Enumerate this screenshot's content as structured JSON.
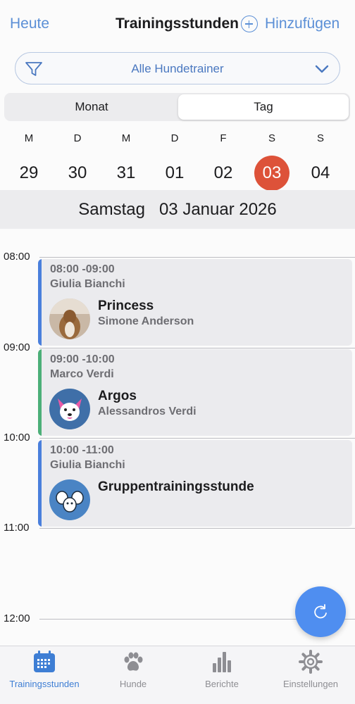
{
  "header": {
    "today_label": "Heute",
    "title": "Trainingsstunden",
    "add_label": "Hinzufügen"
  },
  "filter": {
    "label": "Alle Hundetrainer",
    "icon": "filter-icon",
    "chevron": "chevron-down-icon"
  },
  "segment": {
    "items": [
      "Monat",
      "Tag"
    ],
    "selected": "Tag"
  },
  "week": {
    "days": [
      {
        "letter": "M",
        "number": "29"
      },
      {
        "letter": "D",
        "number": "30"
      },
      {
        "letter": "M",
        "number": "31"
      },
      {
        "letter": "D",
        "number": "01"
      },
      {
        "letter": "F",
        "number": "02"
      },
      {
        "letter": "S",
        "number": "03"
      },
      {
        "letter": "S",
        "number": "04"
      }
    ],
    "selected_number": "03"
  },
  "day_header": "Samstag   03 Januar 2026",
  "timeline": {
    "hours": [
      "08:00",
      "09:00",
      "10:00",
      "11:00",
      "12:00"
    ],
    "events": [
      {
        "time": "08:00 -09:00",
        "trainer": "Giulia Bianchi",
        "dog": "Princess",
        "owner": "Simone Anderson",
        "bar_color": "#4a7fdc"
      },
      {
        "time": "09:00 -10:00",
        "trainer": "Marco Verdi",
        "dog": "Argos",
        "owner": "Alessandros Verdi",
        "bar_color": "#4caf78"
      },
      {
        "time": "10:00 -11:00",
        "trainer": "Giulia Bianchi",
        "dog": "Gruppentrainingsstunde",
        "owner": "",
        "bar_color": "#4a7fdc"
      }
    ]
  },
  "fab": {
    "icon": "refresh-icon",
    "color": "#4f8ef0"
  },
  "tabbar": {
    "tabs": [
      {
        "label": "Trainingsstunden",
        "icon": "calendar-icon",
        "active": true
      },
      {
        "label": "Hunde",
        "icon": "paw-icon",
        "active": false
      },
      {
        "label": "Berichte",
        "icon": "bar-chart-icon",
        "active": false
      },
      {
        "label": "Einstellungen",
        "icon": "gear-icon",
        "active": false
      }
    ]
  },
  "colors": {
    "accent": "#5b8fd6",
    "selected_day": "#dd5239",
    "active_tab": "#3e7ed4"
  }
}
